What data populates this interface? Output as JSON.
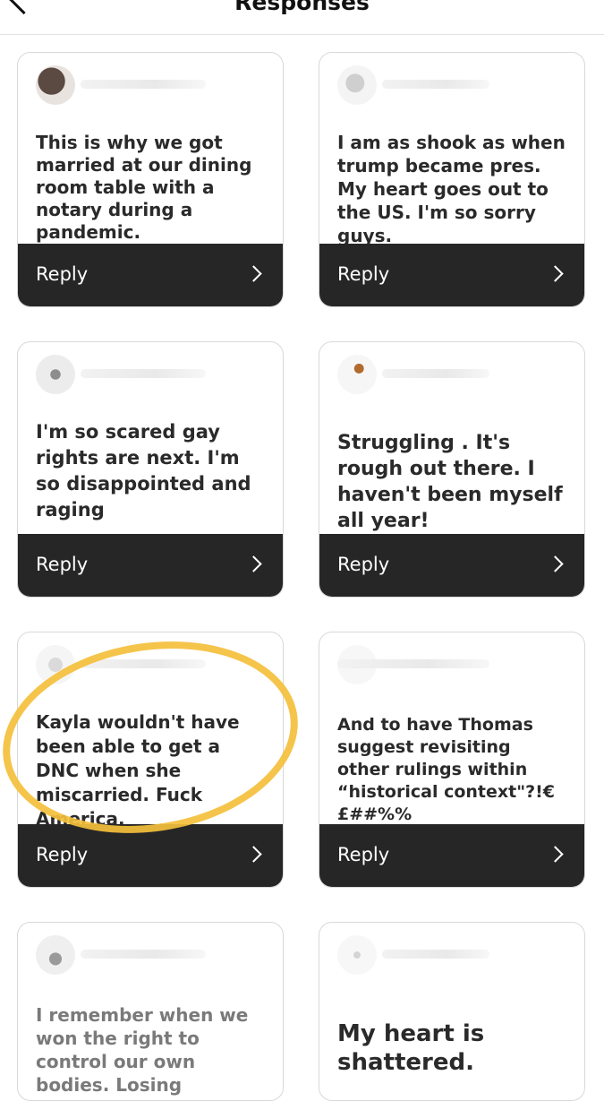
{
  "header": {
    "title": "Responses"
  },
  "reply_label": "Reply",
  "cards": [
    {
      "text": "This is why we got married at our dining room table with a notary during a pandemic."
    },
    {
      "text": "I am as shook as when trump became pres. My heart goes out to the US. I'm so sorry guys."
    },
    {
      "text": "I'm so scared gay rights are next. I'm so disappointed and raging"
    },
    {
      "text": "Struggling . It's rough out there. I haven't been myself all year!"
    },
    {
      "text": "Kayla wouldn't have been able to get a DNC when she miscarried. Fuck America."
    },
    {
      "text": "And to have Thomas suggest revisiting other rulings within “historical context\"?!€£##%%"
    },
    {
      "text": "I remember when we won the right to control our own bodies.  Losing"
    },
    {
      "text": "My heart is shattered."
    }
  ],
  "annotation": {
    "color": "#f4bf3b"
  }
}
